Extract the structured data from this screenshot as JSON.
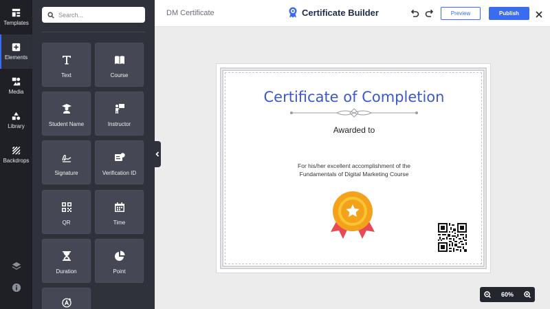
{
  "rail": {
    "items": [
      {
        "label": "Templates",
        "icon": "templates-icon"
      },
      {
        "label": "Elements",
        "icon": "plus-square-icon"
      },
      {
        "label": "Media",
        "icon": "media-icon"
      },
      {
        "label": "Library",
        "icon": "shapes-icon"
      },
      {
        "label": "Backdrops",
        "icon": "hatch-icon"
      }
    ]
  },
  "panel": {
    "search_placeholder": "Search...",
    "tiles": [
      {
        "label": "Text",
        "icon": "text-icon"
      },
      {
        "label": "Course",
        "icon": "book-icon"
      },
      {
        "label": "Student Name",
        "icon": "graduate-icon"
      },
      {
        "label": "Instructor",
        "icon": "instructor-icon"
      },
      {
        "label": "Signature",
        "icon": "signature-icon"
      },
      {
        "label": "Verification ID",
        "icon": "id-card-icon"
      },
      {
        "label": "QR",
        "icon": "qr-icon"
      },
      {
        "label": "Time",
        "icon": "calendar-icon"
      },
      {
        "label": "Duration",
        "icon": "hourglass-icon"
      },
      {
        "label": "Point",
        "icon": "pie-icon"
      },
      {
        "label": "",
        "icon": "font-size-icon"
      }
    ]
  },
  "topbar": {
    "doc_title": "DM Certificate",
    "brand": "Certificate Builder",
    "preview_label": "Preview",
    "publish_label": "Publish"
  },
  "certificate": {
    "title": "Certificate of Completion",
    "awarded": "Awarded to",
    "description_line1": "For his/her excellent accomplishment of the",
    "description_line2": "Fundamentals of Digital Marketing Course"
  },
  "zoom": {
    "level": "60%"
  },
  "colors": {
    "accent": "#3b6cf0",
    "rail_bg": "#1e2026",
    "panel_bg": "#2f323b",
    "tile_bg": "#454854",
    "title_blue": "#3d59c9"
  }
}
